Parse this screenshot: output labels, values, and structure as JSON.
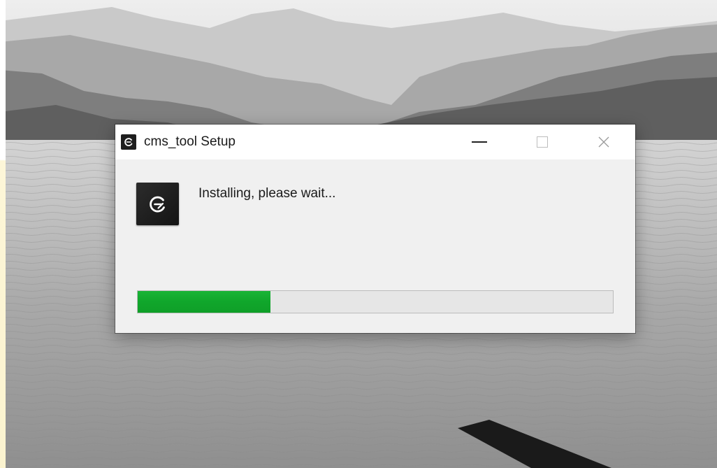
{
  "window": {
    "title": "cms_tool Setup",
    "icon": "cms-tool-app-icon",
    "controls": {
      "minimize": "minimize-icon",
      "maximize": "maximize-icon",
      "close": "close-icon"
    }
  },
  "installer": {
    "status_text": "Installing, please wait...",
    "progress_fraction": 0.28,
    "progress_color": "#15ad31"
  }
}
